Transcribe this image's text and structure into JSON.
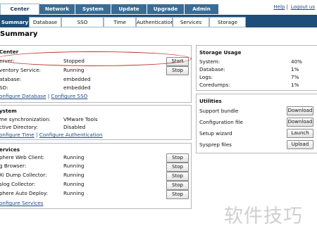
{
  "top_tabs": [
    "Center Server",
    "Network",
    "System",
    "Update",
    "Upgrade",
    "Admin"
  ],
  "top_links": {
    "help": "Help",
    "sep": "|",
    "logout": "Logout us"
  },
  "sub_tabs": [
    "Summary",
    "Database",
    "SSO",
    "Time",
    "Authentication",
    "Services",
    "Storage"
  ],
  "page_title": "Summary",
  "vcenter": {
    "title": "Center",
    "rows": [
      {
        "label": "erver:",
        "value": "Stopped",
        "button": "Start"
      },
      {
        "label": "ventory Service:",
        "value": "Running",
        "button": "Stop"
      },
      {
        "label": "atabase:",
        "value": "embedded",
        "button": ""
      },
      {
        "label": "SO:",
        "value": "embedded",
        "button": ""
      }
    ],
    "links": [
      "onfigure Database",
      "Configure SSO"
    ],
    "link_sep": "|"
  },
  "system": {
    "title": "ystem",
    "rows": [
      {
        "label": "me synchronization:",
        "value": "VMware Tools"
      },
      {
        "label": "ctive Directory:",
        "value": "Disabled"
      }
    ],
    "links": [
      "onfigure Time",
      "Configure Authentication"
    ],
    "link_sep": "|"
  },
  "services": {
    "title": "ervices",
    "rows": [
      {
        "label": "phere Web Client:",
        "value": "Running",
        "button": "Stop"
      },
      {
        "label": "g Browser:",
        "value": "Running",
        "button": "Stop"
      },
      {
        "label": "Xi Dump Collector:",
        "value": "Running",
        "button": "Stop"
      },
      {
        "label": "slog Collector:",
        "value": "Running",
        "button": "Stop"
      },
      {
        "label": "phere Auto Deploy:",
        "value": "Running",
        "button": "Stop"
      }
    ],
    "link": "onfigure Services"
  },
  "storage": {
    "title": "Storage Usage",
    "rows": [
      {
        "label": "System:",
        "value": "40%"
      },
      {
        "label": "Database:",
        "value": "1%"
      },
      {
        "label": "Logs:",
        "value": "7%"
      },
      {
        "label": "Coredumps:",
        "value": "1%"
      }
    ]
  },
  "utilities": {
    "title": "Utilities",
    "rows": [
      {
        "label": "Support bundle",
        "button": "Download"
      },
      {
        "label": "Configuration file",
        "button": "Download"
      },
      {
        "label": "Setup wizard",
        "button": "Launch"
      },
      {
        "label": "Sysprep files",
        "button": "Upload"
      }
    ]
  },
  "watermark": "软件技巧",
  "colors": {
    "header_blue": "#3b6c93",
    "subnav_blue": "#1d4f7a",
    "annotation_red": "#c0302a"
  }
}
